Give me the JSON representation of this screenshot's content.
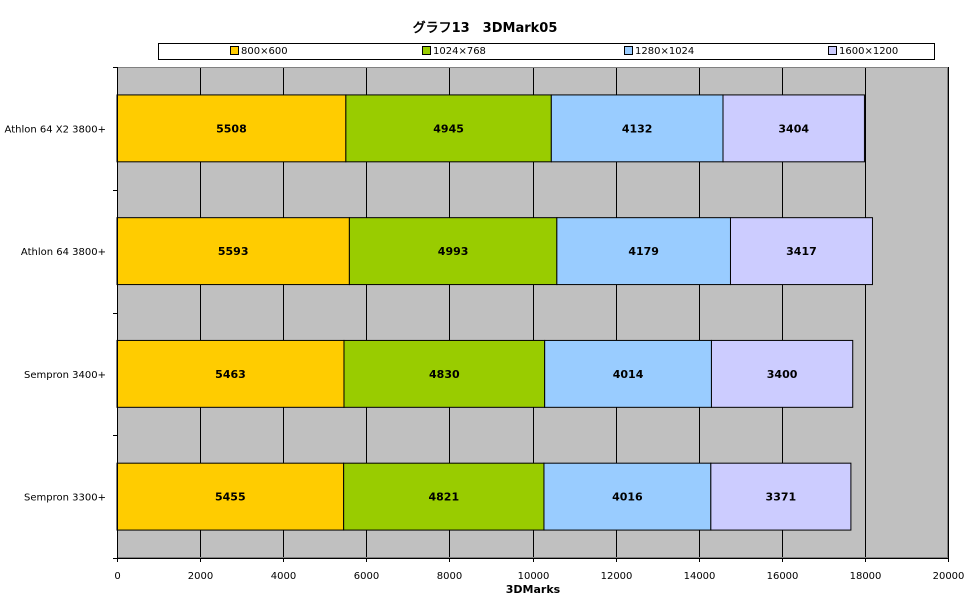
{
  "chart_data": {
    "type": "bar",
    "orientation": "horizontal",
    "stacked": true,
    "title": "グラフ13　3DMark05",
    "xlabel": "3DMarks",
    "ylabel": "",
    "xlim": [
      0,
      20000
    ],
    "x_ticks": [
      "0",
      "2000",
      "4000",
      "6000",
      "8000",
      "10000",
      "12000",
      "14000",
      "16000",
      "18000",
      "20000"
    ],
    "grid": true,
    "legend_position": "top",
    "categories": [
      "Athlon 64 X2 3800+",
      "Athlon 64 3800+",
      "Sempron 3400+",
      "Sempron 3300+"
    ],
    "series": [
      {
        "name": "800×600",
        "color": "#FFCC00",
        "values": [
          5508,
          5593,
          5463,
          5455
        ]
      },
      {
        "name": "1024×768",
        "color": "#99CC00",
        "values": [
          4945,
          4993,
          4830,
          4821
        ]
      },
      {
        "name": "1280×1024",
        "color": "#99CCFF",
        "values": [
          4132,
          4179,
          4014,
          4016
        ]
      },
      {
        "name": "1600×1200",
        "color": "#CCCCFF",
        "values": [
          3404,
          3417,
          3400,
          3371
        ]
      }
    ],
    "plot_background": "#C0C0C0"
  }
}
